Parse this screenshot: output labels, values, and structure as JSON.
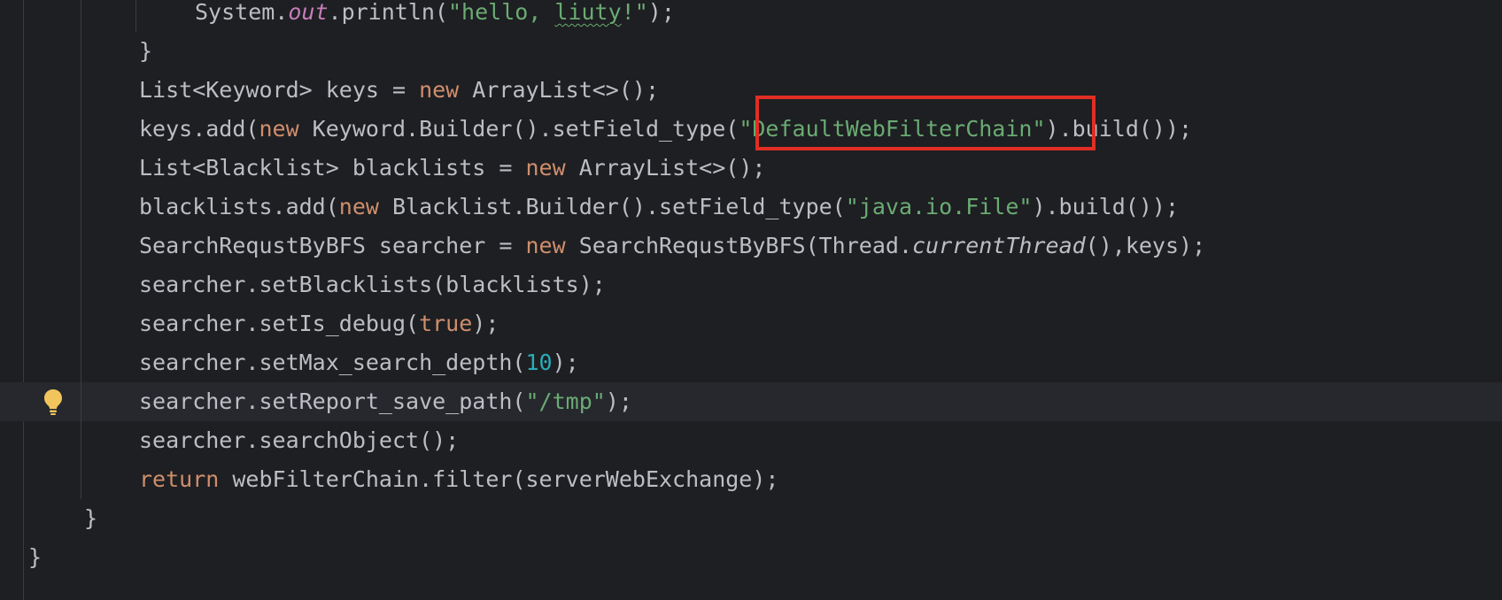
{
  "editor": {
    "lines": [
      {
        "indent": "System.",
        "tokens": [
          {
            "t": "System.",
            "c": ""
          },
          {
            "t": "out",
            "c": "static"
          },
          {
            "t": ".println(",
            "c": ""
          },
          {
            "t": "\"hello, ",
            "c": "str"
          },
          {
            "t": "liuty",
            "c": "str typo"
          },
          {
            "t": "!\"",
            "c": "str"
          },
          {
            "t": ");",
            "c": ""
          }
        ]
      },
      {
        "tokens": [
          {
            "t": "}",
            "c": ""
          }
        ]
      },
      {
        "tokens": [
          {
            "t": "List<Keyword> keys = ",
            "c": ""
          },
          {
            "t": "new",
            "c": "kw"
          },
          {
            "t": " ArrayList<>();",
            "c": ""
          }
        ]
      },
      {
        "tokens": [
          {
            "t": "keys.add(",
            "c": ""
          },
          {
            "t": "new",
            "c": "kw"
          },
          {
            "t": " Keyword.Builder().setField_type(",
            "c": ""
          },
          {
            "t": "\"DefaultWebFilterChain\"",
            "c": "str"
          },
          {
            "t": ").build());",
            "c": ""
          }
        ]
      },
      {
        "tokens": [
          {
            "t": "List<Blacklist> blacklists = ",
            "c": ""
          },
          {
            "t": "new",
            "c": "kw"
          },
          {
            "t": " ArrayList<>();",
            "c": ""
          }
        ]
      },
      {
        "tokens": [
          {
            "t": "blacklists.add(",
            "c": ""
          },
          {
            "t": "new",
            "c": "kw"
          },
          {
            "t": " Blacklist.Builder().setField_type(",
            "c": ""
          },
          {
            "t": "\"java.io.File\"",
            "c": "str"
          },
          {
            "t": ").build());",
            "c": ""
          }
        ]
      },
      {
        "tokens": [
          {
            "t": "SearchRequstByBFS searcher = ",
            "c": ""
          },
          {
            "t": "new",
            "c": "kw"
          },
          {
            "t": " SearchRequstByBFS(Thread.",
            "c": ""
          },
          {
            "t": "currentThread",
            "c": "ital"
          },
          {
            "t": "(),keys);",
            "c": ""
          }
        ]
      },
      {
        "tokens": [
          {
            "t": "searcher.setBlacklists(blacklists);",
            "c": ""
          }
        ]
      },
      {
        "tokens": [
          {
            "t": "searcher.setIs_debug(",
            "c": ""
          },
          {
            "t": "true",
            "c": "kw"
          },
          {
            "t": ");",
            "c": ""
          }
        ]
      },
      {
        "tokens": [
          {
            "t": "searcher.setMax_search_depth(",
            "c": ""
          },
          {
            "t": "10",
            "c": "num"
          },
          {
            "t": ");",
            "c": ""
          }
        ]
      },
      {
        "tokens": [
          {
            "t": "searcher.setReport_save_path(",
            "c": ""
          },
          {
            "t": "\"/tmp\"",
            "c": "str"
          },
          {
            "t": ");",
            "c": ""
          }
        ]
      },
      {
        "tokens": [
          {
            "t": "searcher.searchObject();",
            "c": ""
          }
        ]
      },
      {
        "tokens": [
          {
            "t": "return",
            "c": "kw"
          },
          {
            "t": " webFilterChain.filter(serverWebExchange);",
            "c": ""
          }
        ]
      },
      {
        "tokens": [
          {
            "t": "}",
            "c": ""
          }
        ]
      },
      {
        "tokens": [
          {
            "t": "}",
            "c": ""
          }
        ]
      }
    ],
    "colors": {
      "background": "#1e1f22",
      "text": "#bcbec4",
      "keyword": "#cf8e6d",
      "string": "#6aab73",
      "number": "#2aacb8",
      "static_field": "#c77dbb",
      "highlight_box": "#e02e24",
      "bulb": "#f2c55c"
    },
    "icons": {
      "gutter_intention": "lightbulb-icon"
    }
  }
}
